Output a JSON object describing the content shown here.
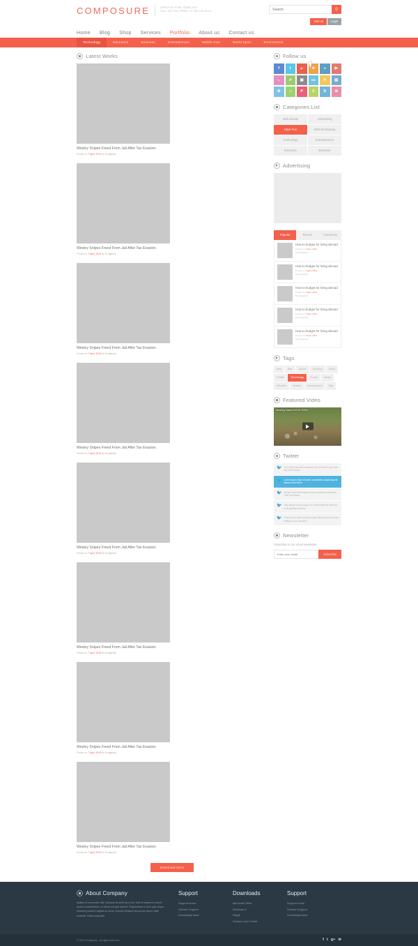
{
  "header": {
    "logo": "COMPOSURE",
    "tagline_line1": "CREATIVE HTML TEMPLATE",
    "tagline_line2": "CALL US TOLL FREE: +2 000 123 45 67",
    "search_placeholder": "Search",
    "search_value": "",
    "join_label": "Join us",
    "login_label": "Login",
    "accent_color": "#f4604b"
  },
  "mainnav": [
    {
      "label": "Home",
      "active": false
    },
    {
      "label": "Blog",
      "active": false
    },
    {
      "label": "Shop",
      "active": false
    },
    {
      "label": "Services",
      "active": false
    },
    {
      "label": "Portfolio",
      "active": true
    },
    {
      "label": "About us",
      "active": false
    },
    {
      "label": "Contact us",
      "active": false
    }
  ],
  "subnav": [
    {
      "label": "Technology",
      "active": true
    },
    {
      "label": "Education",
      "active": false
    },
    {
      "label": "Business",
      "active": false
    },
    {
      "label": "Entertainment",
      "active": false
    },
    {
      "label": "Middle East",
      "active": false
    },
    {
      "label": "World Sport",
      "active": false
    },
    {
      "label": "Environment",
      "active": false
    }
  ],
  "main": {
    "title": "Latest Works",
    "works": [
      {
        "title": "Wesley Snipes Freed From Jail After Tax Evasion.",
        "posted": "Posted on ",
        "date": "7 April, 2013",
        "by": " By ",
        "author": "M-elgendy"
      },
      {
        "title": "Wesley Snipes Freed From Jail After Tax Evasion.",
        "posted": "Posted on ",
        "date": "7 April, 2013",
        "by": " By ",
        "author": "M-elgendy"
      },
      {
        "title": "Wesley Snipes Freed From Jail After Tax Evasion.",
        "posted": "Posted on ",
        "date": "7 April, 2013",
        "by": " By ",
        "author": "M-elgendy"
      },
      {
        "title": "Wesley Snipes Freed From Jail After Tax Evasion.",
        "posted": "Posted on ",
        "date": "7 April, 2013",
        "by": " By ",
        "author": "M-elgendy"
      },
      {
        "title": "Wesley Snipes Freed From Jail After Tax Evasion.",
        "posted": "Posted on ",
        "date": "7 April, 2013",
        "by": " By ",
        "author": "M-elgendy"
      },
      {
        "title": "Wesley Snipes Freed From Jail After Tax Evasion.",
        "posted": "Posted on ",
        "date": "7 April, 2013",
        "by": " By ",
        "author": "M-elgendy"
      },
      {
        "title": "Wesley Snipes Freed From Jail After Tax Evasion.",
        "posted": "Posted on ",
        "date": "7 April, 2013",
        "by": " By ",
        "author": "M-elgendy"
      },
      {
        "title": "Wesley Snipes Freed From Jail After Tax Evasion.",
        "posted": "Posted on ",
        "date": "7 April, 2013",
        "by": " By ",
        "author": "M-elgendy"
      }
    ],
    "download_more": "Download More"
  },
  "sidebar": {
    "follow": {
      "title": "Follow us",
      "icons": [
        {
          "name": "facebook-icon",
          "glyph": "f",
          "color": "#5b8bd0"
        },
        {
          "name": "twitter-icon",
          "glyph": "t",
          "color": "#5fc4ea"
        },
        {
          "name": "google-plus-icon",
          "glyph": "g+",
          "color": "#e8604c"
        },
        {
          "name": "rss-icon",
          "glyph": "≋",
          "color": "#f0a14a"
        },
        {
          "name": "linkedin-icon",
          "glyph": "in",
          "color": "#5e9dc4"
        },
        {
          "name": "youtube-icon",
          "glyph": "▶",
          "color": "#e27b6e"
        },
        {
          "name": "flickr-icon",
          "glyph": "••",
          "color": "#e490c0"
        },
        {
          "name": "evernote-icon",
          "glyph": "✔",
          "color": "#9ecb72"
        },
        {
          "name": "instagram-icon",
          "glyph": "▣",
          "color": "#8c8c8c"
        },
        {
          "name": "500px-icon",
          "glyph": "500",
          "color": "#6fc4e0"
        },
        {
          "name": "deviantart-icon",
          "glyph": "✈",
          "color": "#f2c85c"
        },
        {
          "name": "dropbox-icon",
          "glyph": "▤",
          "color": "#7ba9d4"
        },
        {
          "name": "dribbble-icon",
          "glyph": "✿",
          "color": "#7fc2e6"
        },
        {
          "name": "lastfm-icon",
          "glyph": "♫",
          "color": "#9dd36f"
        },
        {
          "name": "pinterest-icon",
          "glyph": "P",
          "color": "#e8607a"
        },
        {
          "name": "zerply-icon",
          "glyph": "Z",
          "color": "#b8d36a"
        },
        {
          "name": "skype-icon",
          "glyph": "S",
          "color": "#72b5d8"
        },
        {
          "name": "dribbble-alt-icon",
          "glyph": "⊚",
          "color": "#e88fa8"
        }
      ]
    },
    "categories": {
      "title": "Categories List",
      "items": [
        {
          "label": "Web Design",
          "active": false
        },
        {
          "label": "Advertising",
          "active": false
        },
        {
          "label": "Have Fun",
          "active": true
        },
        {
          "label": "Web Developing",
          "active": false
        },
        {
          "label": "Technology",
          "active": false
        },
        {
          "label": "Entertainment",
          "active": false
        },
        {
          "label": "Education",
          "active": false
        },
        {
          "label": "Business",
          "active": false
        }
      ]
    },
    "advertising": {
      "title": "Advertising"
    },
    "posts": {
      "tabs": [
        {
          "label": "Popular",
          "active": true
        },
        {
          "label": "Recent",
          "active": false
        },
        {
          "label": "Comments",
          "active": false
        }
      ],
      "items": [
        {
          "title": "How to budget for living abroad",
          "posted": "Posted on ",
          "date": "7 April, 2013",
          "by": "By ",
          "author": "M-elgendy"
        },
        {
          "title": "How to budget for living abroad",
          "posted": "Posted on ",
          "date": "7 April, 2013",
          "by": "By ",
          "author": "M-elgendy"
        },
        {
          "title": "How to budget for living abroad",
          "posted": "Posted on ",
          "date": "7 April, 2013",
          "by": "By ",
          "author": "M-elgendy"
        },
        {
          "title": "How to budget for living abroad",
          "posted": "Posted on ",
          "date": "7 April, 2013",
          "by": "By ",
          "author": "M-elgendy"
        },
        {
          "title": "How to budget for living abroad",
          "posted": "Posted on ",
          "date": "7 April, 2013",
          "by": "By ",
          "author": "M-elgendy"
        }
      ]
    },
    "tags": {
      "title": "Tags",
      "items": [
        {
          "label": "Arts",
          "active": false
        },
        {
          "label": "War",
          "active": false
        },
        {
          "label": "Sports",
          "active": false
        },
        {
          "label": "Shoping",
          "active": false
        },
        {
          "label": "Autos",
          "active": false
        },
        {
          "label": "Health",
          "active": false
        },
        {
          "label": "Technology",
          "active": true
        },
        {
          "label": "Future",
          "active": false
        },
        {
          "label": "Music",
          "active": false
        },
        {
          "label": "Weather",
          "active": false
        },
        {
          "label": "Movies",
          "active": false
        },
        {
          "label": "Environment",
          "active": false
        },
        {
          "label": "War",
          "active": false
        }
      ]
    },
    "video": {
      "title": "Featured Video",
      "video_title": "Amazing Nature full HD 1080p"
    },
    "twitter": {
      "title": "Twitter",
      "tweets": [
        {
          "text": "Your ticket has been answered, let us know if you have any other issues.",
          "highlight": false
        },
        {
          "text": "Lorem ipsum dolor sit amet, consectetur adipiscing elit. Mauris enim lorem",
          "highlight": true
        },
        {
          "text": "Integer varius felis aliquet neque molestie scelerisque. Cras consequat.",
          "highlight": false
        },
        {
          "text": "Duis aliquet auctor augue eu Suspendisse sit amet leo a elit gravida faucibus.",
          "highlight": false
        },
        {
          "text": "Praesent ac varius Quisque ligula Maecenas accumsan tristique orci in faucibus.",
          "highlight": false
        }
      ]
    },
    "newsletter": {
      "title": "Newsletter",
      "subtitle": "Subscribe to our email newsletter.",
      "placeholder": "Enter your email",
      "value": "",
      "button": "Subscribe"
    }
  },
  "footer": {
    "about": {
      "title": "About Company",
      "text": "Nullam ut commodo velit. Quisque sit amet arcu nisi. Sed id massa et mauris lacinia condimentum. In luctus suscipit laoreet. Suspendisse a arcu quis neque tincidunt posuere sagittis ac lacus. Aenean tristique accumsan ipsum vitae molestie. Etiam vulputate."
    },
    "columns": [
      {
        "title": "Support",
        "links": [
          "Support home",
          "Surface Support",
          "Knowledge base"
        ]
      },
      {
        "title": "Downloads",
        "links": [
          "Microsoft Office",
          "Windows 8",
          "Skype",
          "Surface User Guide"
        ]
      },
      {
        "title": "Support",
        "links": [
          "Support home",
          "Surface Support",
          "Knowledge base"
        ]
      }
    ],
    "copyright": "© 2013 M-elgendy - All rights reserved.",
    "social": [
      {
        "name": "facebook-icon",
        "glyph": "f"
      },
      {
        "name": "twitter-icon",
        "glyph": "t"
      },
      {
        "name": "google-plus-icon",
        "glyph": "g+"
      },
      {
        "name": "rss-icon",
        "glyph": "≋"
      }
    ]
  }
}
